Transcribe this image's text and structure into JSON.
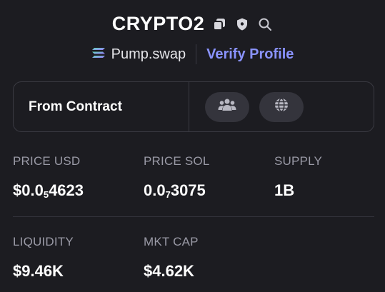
{
  "header": {
    "token_name": "CRYPTO2",
    "icons": [
      "copy-icon",
      "shield-icon",
      "search-icon"
    ],
    "dex_name": "Pump.swap",
    "dex_icon": "pump-swap-logo-icon",
    "verify_label": "Verify Profile"
  },
  "contract": {
    "label": "From Contract",
    "social_icons": [
      "community-icon",
      "globe-icon"
    ]
  },
  "stats": {
    "price_usd": {
      "label": "PRICE USD",
      "prefix": "$0.0",
      "zeros": "5",
      "digits": "4623"
    },
    "price_sol": {
      "label": "PRICE SOL",
      "prefix": "0.0",
      "zeros": "7",
      "digits": "3075"
    },
    "supply": {
      "label": "SUPPLY",
      "value": "1B"
    },
    "liquidity": {
      "label": "LIQUIDITY",
      "value": "$9.46K"
    },
    "mkt_cap": {
      "label": "MKT CAP",
      "value": "$4.62K"
    }
  },
  "colors": {
    "background": "#1c1c21",
    "accent": "#8a93ff",
    "muted": "#9a9aa6",
    "border": "#3a3a42"
  }
}
